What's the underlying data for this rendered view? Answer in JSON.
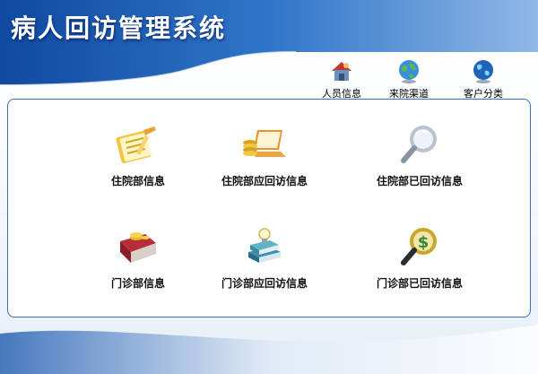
{
  "app": {
    "title": "病人回访管理系统"
  },
  "top_nav": {
    "items": [
      {
        "label": "人员信息",
        "icon": "house-person-icon"
      },
      {
        "label": "来院渠道",
        "icon": "globe-icon"
      },
      {
        "label": "客户分类",
        "icon": "globe-blue-icon"
      }
    ]
  },
  "tiles": [
    {
      "label": "住院部信息",
      "icon": "notebook-pencil-icon"
    },
    {
      "label": "住院部应回访信息",
      "icon": "laptop-coins-icon"
    },
    {
      "label": "住院部已回访信息",
      "icon": "magnifier-icon"
    },
    {
      "label": "门诊部信息",
      "icon": "book-coins-icon"
    },
    {
      "label": "门诊部应回访信息",
      "icon": "book-stack-bulb-icon"
    },
    {
      "label": "门诊部已回访信息",
      "icon": "magnifier-dollar-icon"
    }
  ],
  "colors": {
    "header_blue": "#1f5ba8",
    "panel_border": "#3b6fb8",
    "panel_bg": "#ffffff"
  }
}
